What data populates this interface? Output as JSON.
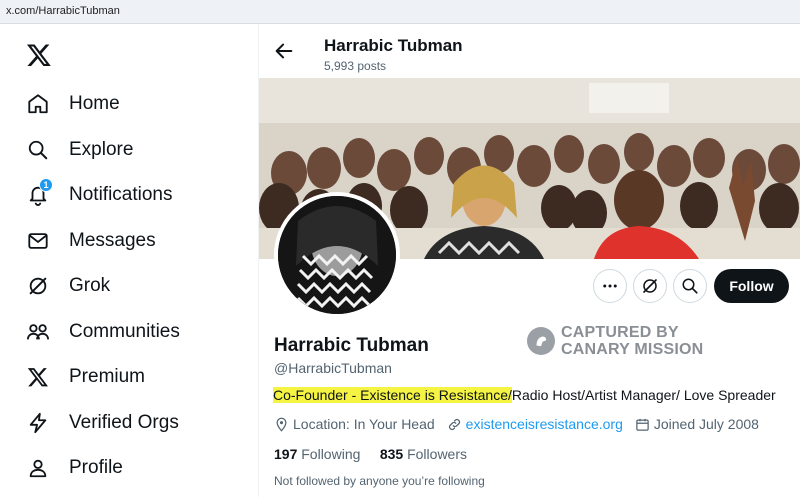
{
  "browser": {
    "url": "x.com/HarrabicTubman"
  },
  "sidebar": {
    "logo_icon": "x-logo-icon",
    "items": [
      {
        "label": "Home",
        "icon": "home-icon"
      },
      {
        "label": "Explore",
        "icon": "search-icon"
      },
      {
        "label": "Notifications",
        "icon": "bell-icon",
        "badge": "1"
      },
      {
        "label": "Messages",
        "icon": "envelope-icon"
      },
      {
        "label": "Grok",
        "icon": "grok-icon"
      },
      {
        "label": "Communities",
        "icon": "people-icon"
      },
      {
        "label": "Premium",
        "icon": "x-logo-icon"
      },
      {
        "label": "Verified Orgs",
        "icon": "lightning-icon"
      },
      {
        "label": "Profile",
        "icon": "person-icon"
      }
    ]
  },
  "header": {
    "name": "Harrabic Tubman",
    "posts": "5,993 posts"
  },
  "profile": {
    "name": "Harrabic Tubman",
    "handle": "@HarrabicTubman",
    "bio_highlighted": "Co-Founder - Existence is Resistance/",
    "bio_rest": "Radio Host/Artist Manager/ Love Spreader",
    "location": "Location: In Your Head",
    "website": "existenceisresistance.org",
    "joined": "Joined July 2008",
    "following_count": "197",
    "following_label": "Following",
    "followers_count": "835",
    "followers_label": "Followers",
    "not_followed": "Not followed by anyone you’re following",
    "follow_label": "Follow"
  },
  "watermark": {
    "line1": "CAPTURED BY",
    "line2": "CANARY MISSION"
  },
  "colors": {
    "accent": "#1d9bf0",
    "highlight": "#f5f442",
    "follow_bg": "#0f1419"
  }
}
